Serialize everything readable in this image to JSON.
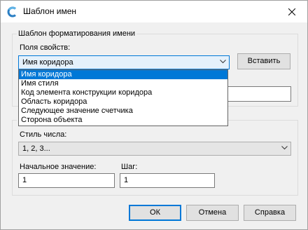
{
  "window": {
    "title": "Шаблон имен"
  },
  "format_group": {
    "title": "Шаблон форматирования имени",
    "property_fields_label": "Поля свойств:",
    "property_selected": "Имя коридора",
    "insert_button": "Вставить",
    "dropdown_items": [
      "Имя коридора",
      "Имя стиля",
      "Код элемента конструкции коридора",
      "Область коридора",
      "Следующее значение счетчика",
      "Сторона объекта"
    ],
    "template_value": ""
  },
  "counter_group": {
    "title_visible": "С",
    "number_style_label": "Стиль числа:",
    "number_style_value": "1, 2, 3...",
    "start_label": "Начальное значение:",
    "start_value": "1",
    "step_label": "Шаг:",
    "step_value": "1"
  },
  "buttons": {
    "ok": "ОК",
    "cancel": "Отмена",
    "help": "Справка"
  },
  "colors": {
    "accent": "#0078d7",
    "dialog_bg": "#f0f0f0"
  },
  "icons": {
    "app": "autocad-civil3d-icon",
    "close": "close-icon",
    "dropdown": "chevron-down-icon"
  }
}
